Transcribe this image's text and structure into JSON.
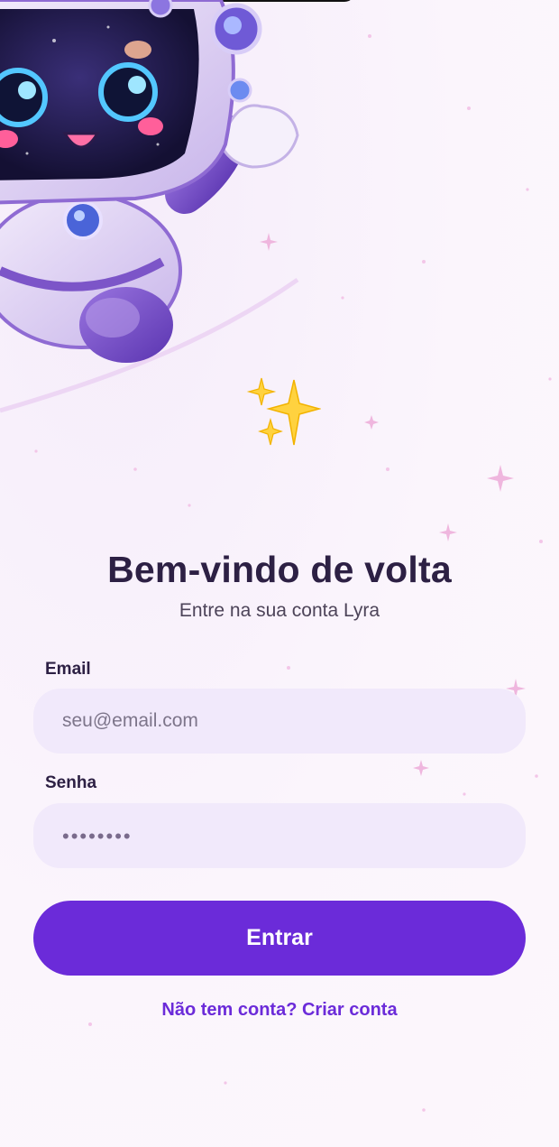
{
  "login": {
    "title": "Bem-vindo de volta",
    "subtitle": "Entre na sua conta Lyra",
    "email_label": "Email",
    "email_placeholder": "seu@email.com",
    "password_label": "Senha",
    "password_masked": "••••••••",
    "submit_label": "Entrar",
    "signup_link": "Não tem conta? Criar conta"
  },
  "colors": {
    "primary": "#6b2bd9",
    "field_bg": "#f1e9fb",
    "title": "#2d2044",
    "background": "#fbf5fc"
  },
  "icons": [
    "astronaut-illustration",
    "sparkles-emoji"
  ]
}
